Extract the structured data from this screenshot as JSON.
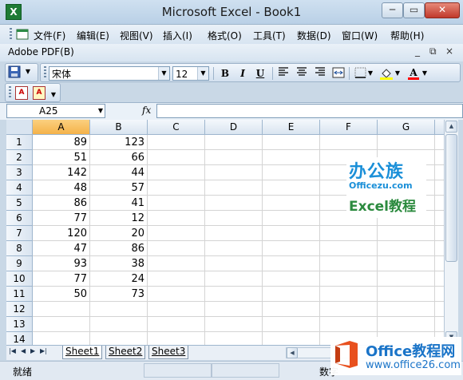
{
  "window": {
    "title": "Microsoft Excel - Book1",
    "minimize_glyph": "─",
    "restore_glyph": "▭",
    "close_glyph": "✕"
  },
  "menubar": {
    "items": [
      "文件(F)",
      "编辑(E)",
      "视图(V)",
      "插入(I)",
      "格式(O)",
      "工具(T)",
      "数据(D)",
      "窗口(W)",
      "帮助(H)"
    ],
    "doc_controls": [
      "_",
      "⧉",
      "×"
    ]
  },
  "adobebar": {
    "label": "Adobe PDF(B)"
  },
  "format_toolbar": {
    "font_name": "宋体",
    "font_size": "12",
    "bold": "B",
    "italic": "I",
    "underline": "U",
    "font_color_letter": "A",
    "font_color": "#ff0000",
    "fill_color": "#ffff00"
  },
  "pdf_toolbar": {
    "icons": [
      "pdf-convert-icon",
      "pdf-email-icon"
    ]
  },
  "formula_bar": {
    "name_box": "A25",
    "fx_label": "fx",
    "formula": ""
  },
  "grid": {
    "columns": [
      "A",
      "B",
      "C",
      "D",
      "E",
      "F",
      "G"
    ],
    "selected_column": "A",
    "row_numbers": [
      "1",
      "2",
      "3",
      "4",
      "5",
      "6",
      "7",
      "8",
      "9",
      "10",
      "11",
      "12",
      "13",
      "14"
    ],
    "cells_A": [
      "89",
      "51",
      "142",
      "48",
      "86",
      "77",
      "120",
      "47",
      "93",
      "77",
      "50",
      "",
      "",
      ""
    ],
    "cells_B": [
      "123",
      "66",
      "44",
      "57",
      "41",
      "12",
      "20",
      "86",
      "38",
      "24",
      "73",
      "",
      "",
      ""
    ]
  },
  "sheets": {
    "tabs": [
      "Sheet1",
      "Sheet2",
      "Sheet3"
    ],
    "active": "Sheet1"
  },
  "statusbar": {
    "left": "就绪",
    "num": "数字"
  },
  "watermark1": {
    "title": "办公族",
    "domain": "Officezu.com",
    "subtitle": "Excel教程"
  },
  "watermark2": {
    "title": "Office教程网",
    "domain": "www.office26.com"
  }
}
